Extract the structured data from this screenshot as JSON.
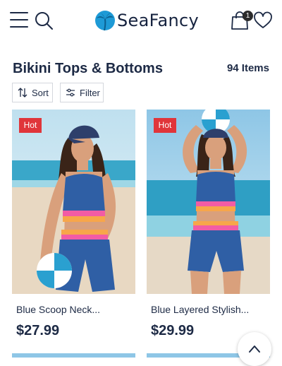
{
  "header": {
    "logo_text": "SeaFancy",
    "cart_count": "1"
  },
  "listing": {
    "title": "Bikini Tops & Bottoms",
    "item_count": "94 Items",
    "sort_label": "Sort",
    "filter_label": "Filter"
  },
  "products": [
    {
      "badge": "Hot",
      "name": "Blue Scoop Neck...",
      "price": "$27.99"
    },
    {
      "badge": "Hot",
      "name": "Blue Layered Stylish...",
      "price": "$29.99"
    }
  ],
  "icons": [
    "menu-icon",
    "search-icon",
    "palm-logo-icon",
    "shopping-bag-icon",
    "heart-icon",
    "sort-icon",
    "filter-sliders-icon",
    "chevron-up-icon"
  ],
  "colors": {
    "text": "#1d2a45",
    "badge": "#e0353a",
    "logo": "#1e9ad6"
  }
}
